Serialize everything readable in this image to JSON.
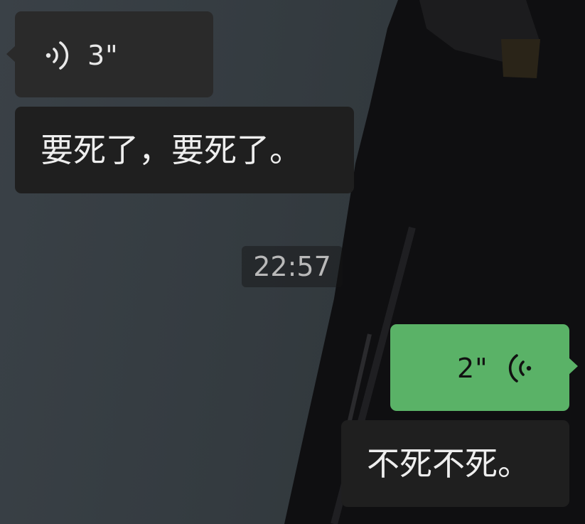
{
  "messages": [
    {
      "type": "voice",
      "side": "left",
      "duration": "3\""
    },
    {
      "type": "text",
      "side": "left",
      "text": "要死了，要死了。"
    },
    {
      "type": "time",
      "text": "22:57"
    },
    {
      "type": "voice",
      "side": "right",
      "duration": "2\""
    },
    {
      "type": "text",
      "side": "right",
      "text": "不死不死。"
    }
  ],
  "colors": {
    "incoming_bubble": "#2a2a2a",
    "text_bubble": "#1f1f1f",
    "outgoing_voice_bubble": "#5ab267",
    "timestamp_text": "#b9b9b9"
  },
  "icons": {
    "incoming_voice": "voice-wave-icon",
    "outgoing_voice": "voice-wave-icon"
  }
}
